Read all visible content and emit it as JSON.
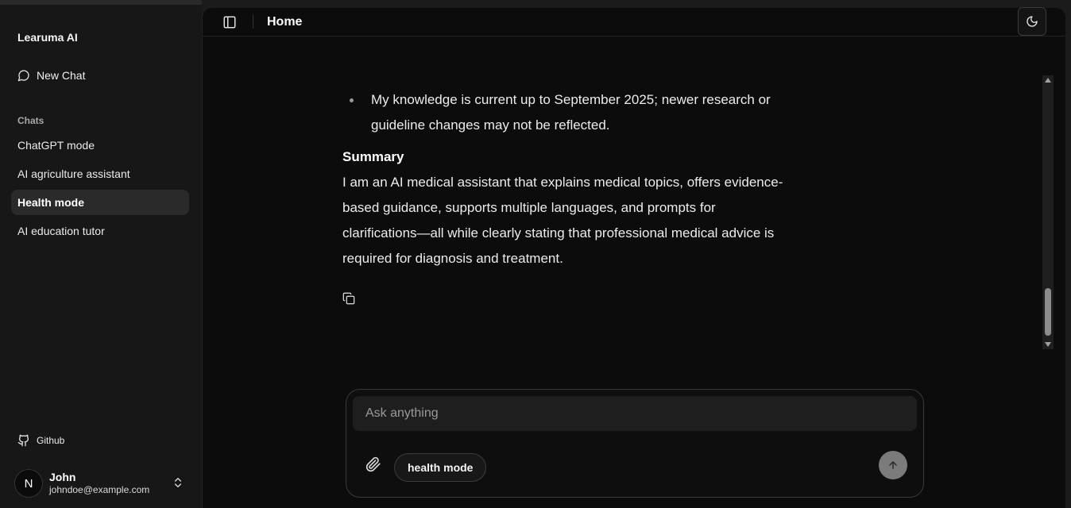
{
  "sidebar": {
    "app_title": "Learuma AI",
    "new_chat_label": "New Chat",
    "chats_label": "Chats",
    "chats": [
      {
        "label": "ChatGPT mode",
        "active": false
      },
      {
        "label": "AI agriculture assistant",
        "active": false
      },
      {
        "label": "Health mode",
        "active": true
      },
      {
        "label": "AI education tutor",
        "active": false
      }
    ],
    "github_label": "Github",
    "user": {
      "initial": "N",
      "name": "John",
      "email": "johndoe@example.com"
    }
  },
  "header": {
    "title": "Home"
  },
  "message": {
    "bullet_text": "My knowledge is current up to September 2025; newer research or guideline changes may not be reflected.",
    "summary_heading": "Summary",
    "summary_text": "I am an AI medical assistant that explains medical topics, offers evidence-based guidance, supports multiple languages, and prompts for clarifications—all while clearly stating that professional medical advice is required for diagnosis and treatment."
  },
  "composer": {
    "placeholder": "Ask anything",
    "mode_label": "health mode"
  },
  "icons": {
    "new_chat": "message-circle-icon",
    "github": "github-icon",
    "user_toggle": "chevrons-up-down-icon",
    "sidebar_toggle": "panel-left-icon",
    "theme": "moon-icon",
    "copy": "copy-icon",
    "attach": "paperclip-icon",
    "send": "arrow-up-icon"
  },
  "colors": {
    "sidebar_bg": "#171717",
    "main_bg": "#0c0c0d",
    "active_item_bg": "#2a2a2a",
    "send_button": "#7b7b7b"
  }
}
